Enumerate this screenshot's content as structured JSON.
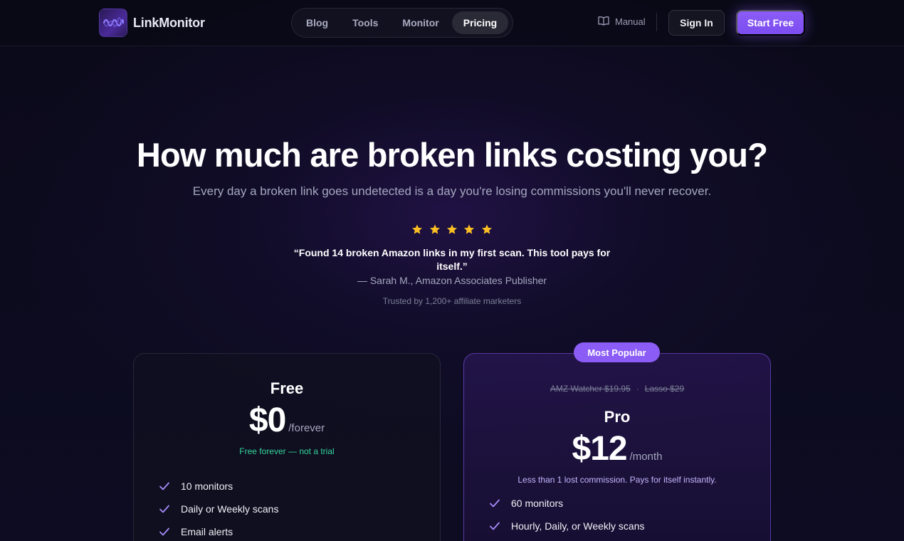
{
  "header": {
    "brand_name": "LinkMonitor",
    "nav": [
      {
        "label": "Blog",
        "active": false
      },
      {
        "label": "Tools",
        "active": false
      },
      {
        "label": "Monitor",
        "active": false
      },
      {
        "label": "Pricing",
        "active": true
      }
    ],
    "manual_label": "Manual",
    "signin_label": "Sign In",
    "start_label": "Start Free",
    "accent_color": "#8b5cf6"
  },
  "hero": {
    "title": "How much are broken links costing you?",
    "subtitle": "Every day a broken link goes undetected is a day you're losing commissions you'll never recover.",
    "rating": 5,
    "quote": "“Found 14 broken Amazon links in my first scan. This tool pays for itself.”",
    "quote_author": "— Sarah M., Amazon Associates Publisher",
    "trusted": "Trusted by 1,200+ affiliate marketers"
  },
  "plans": {
    "free": {
      "name": "Free",
      "price": "$0",
      "period": "/forever",
      "note": "Free forever — not a trial",
      "features": [
        "10 monitors",
        "Daily or Weekly scans",
        "Email alerts"
      ]
    },
    "pro": {
      "badge": "Most Popular",
      "competitor_1": "AMZ Watcher $19.95",
      "competitor_separator": "·",
      "competitor_2": "Lasso $29",
      "name": "Pro",
      "price": "$12",
      "period": "/month",
      "note": "Less than 1 lost commission. Pays for itself instantly.",
      "features": [
        "60 monitors",
        "Hourly, Daily, or Weekly scans"
      ]
    }
  },
  "icons": {
    "logo": "waveform-logo-icon",
    "manual": "book-icon",
    "star": "star-icon",
    "check": "check-icon",
    "star_color": "#fbbf24",
    "check_color": "#a78bfa",
    "free_note_color": "#34d399"
  }
}
